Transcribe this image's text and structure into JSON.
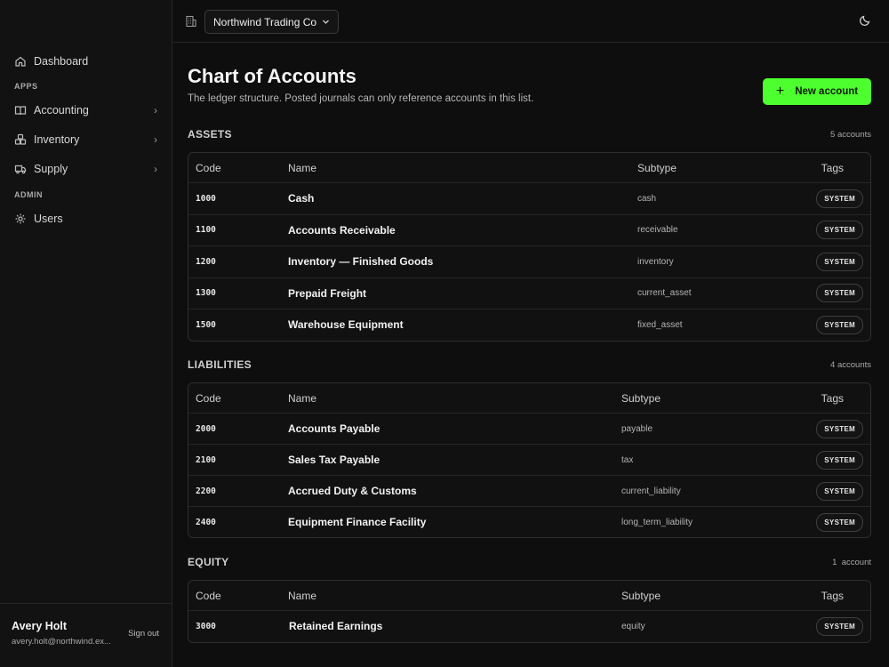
{
  "sidebar": {
    "dashboard": "Dashboard",
    "apps_label": "APPS",
    "apps": [
      {
        "label": "Accounting",
        "icon": "book-icon"
      },
      {
        "label": "Inventory",
        "icon": "boxes-icon"
      },
      {
        "label": "Supply",
        "icon": "truck-icon"
      }
    ],
    "admin_label": "ADMIN",
    "users": "Users",
    "user": {
      "name": "Avery Holt",
      "email": "avery.holt@northwind.ex...",
      "signout": "Sign out"
    }
  },
  "topbar": {
    "company": "Northwind Trading Co"
  },
  "page": {
    "title": "Chart of Accounts",
    "subtitle": "The ledger structure. Posted journals can only reference accounts in this list.",
    "new_button": "New account"
  },
  "columns": {
    "code": "Code",
    "name": "Name",
    "subtype": "Subtype",
    "tags": "Tags"
  },
  "sections": [
    {
      "title": "ASSETS",
      "count": "5 accounts",
      "rows": [
        {
          "code": "1000",
          "name": "Cash",
          "subtype": "cash",
          "tag": "SYSTEM"
        },
        {
          "code": "1100",
          "name": "Accounts Receivable",
          "subtype": "receivable",
          "tag": "SYSTEM"
        },
        {
          "code": "1200",
          "name": "Inventory — Finished Goods",
          "subtype": "inventory",
          "tag": "SYSTEM"
        },
        {
          "code": "1300",
          "name": "Prepaid Freight",
          "subtype": "current_asset",
          "tag": "SYSTEM"
        },
        {
          "code": "1500",
          "name": "Warehouse Equipment",
          "subtype": "fixed_asset",
          "tag": "SYSTEM"
        }
      ]
    },
    {
      "title": "LIABILITIES",
      "count": "4 accounts",
      "rows": [
        {
          "code": "2000",
          "name": "Accounts Payable",
          "subtype": "payable",
          "tag": "SYSTEM"
        },
        {
          "code": "2100",
          "name": "Sales Tax Payable",
          "subtype": "tax",
          "tag": "SYSTEM"
        },
        {
          "code": "2200",
          "name": "Accrued Duty & Customs",
          "subtype": "current_liability",
          "tag": "SYSTEM"
        },
        {
          "code": "2400",
          "name": "Equipment Finance Facility",
          "subtype": "long_term_liability",
          "tag": "SYSTEM"
        }
      ]
    },
    {
      "title": "EQUITY",
      "count": "1  account",
      "rows": [
        {
          "code": "3000",
          "name": "Retained Earnings",
          "subtype": "equity",
          "tag": "SYSTEM"
        }
      ]
    }
  ],
  "colors": {
    "accent": "#4dff2e",
    "background": "#0e0e0e",
    "sidebar": "#121212"
  }
}
